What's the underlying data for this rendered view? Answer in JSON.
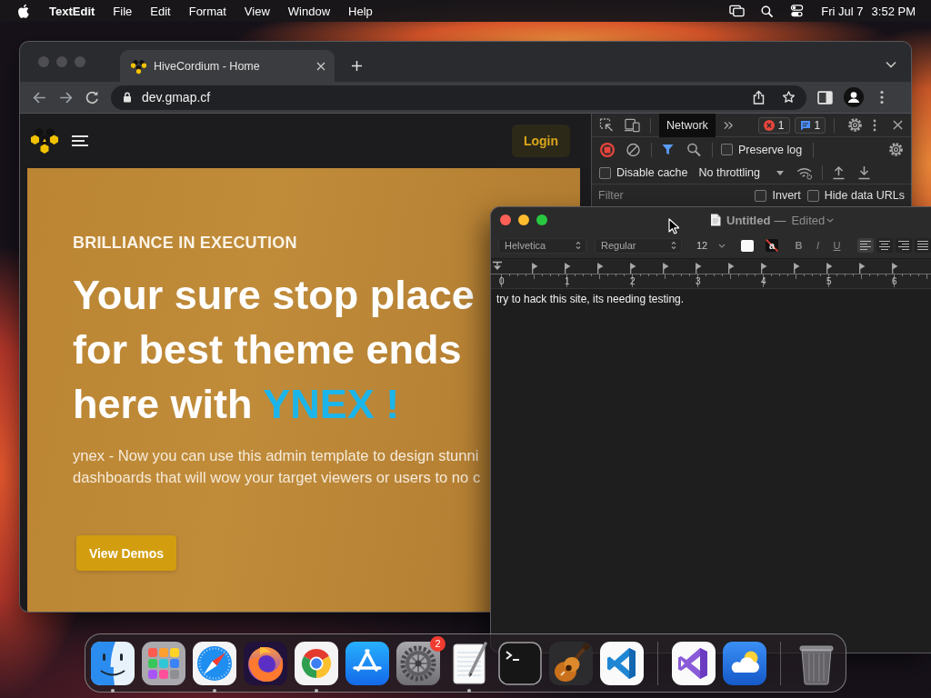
{
  "menu_bar": {
    "app_name": "TextEdit",
    "menus": [
      "File",
      "Edit",
      "Format",
      "View",
      "Window",
      "Help"
    ],
    "date": "Fri Jul 7",
    "time": "3:52 PM"
  },
  "browser": {
    "tabs": [
      {
        "title": "HiveCordium - Home",
        "selected": true
      }
    ],
    "address": "dev.gmap.cf",
    "page": {
      "login_button": "Login",
      "eyebrow": "BRILLIANCE IN EXECUTION",
      "headline_lines": [
        "Your sure stop place",
        "for best theme ends",
        "here with"
      ],
      "headline_accent": "YNEX !",
      "description_lines": [
        "ynex - Now you can use this admin template to design stunni",
        "dashboards that will wow your target viewers or users to no c"
      ],
      "cta_button": "View Demos"
    },
    "devtools": {
      "tabs": [
        {
          "label": "Network",
          "selected": true
        }
      ],
      "error_count": "1",
      "message_count": "1",
      "recording": true,
      "preserve_log": {
        "label": "Preserve log",
        "checked": false
      },
      "disable_cache": {
        "label": "Disable cache",
        "checked": false
      },
      "throttling": "No throttling",
      "filter_placeholder": "Filter",
      "filter_options": [
        {
          "label": "Invert",
          "checked": false
        },
        {
          "label": "Hide data URLs",
          "checked": false
        }
      ]
    }
  },
  "textedit": {
    "title": "Untitled",
    "separator": "—",
    "status": "Edited",
    "font": "Helvetica",
    "style": "Regular",
    "size": "12",
    "highlight_label": "a",
    "style_buttons": [
      {
        "kind": "bold",
        "label": "B"
      },
      {
        "kind": "italic",
        "label": "I"
      },
      {
        "kind": "underline",
        "label": "U"
      }
    ],
    "alignments": [
      {
        "kind": "left",
        "selected": true
      },
      {
        "kind": "center",
        "selected": false
      },
      {
        "kind": "right",
        "selected": false
      },
      {
        "kind": "justify",
        "selected": false
      }
    ],
    "ruler_numbers": [
      "0",
      "1",
      "2",
      "3",
      "4",
      "5",
      "6"
    ],
    "text": "try to hack this site, its needing testing."
  },
  "dock": {
    "items": [
      {
        "kind": "finder",
        "running": true
      },
      {
        "kind": "launchpad",
        "running": false
      },
      {
        "kind": "safari",
        "running": true
      },
      {
        "kind": "firefox",
        "running": false
      },
      {
        "kind": "chrome",
        "running": true
      },
      {
        "kind": "appstore",
        "running": false
      },
      {
        "kind": "settings",
        "running": false,
        "badge": "2"
      },
      {
        "kind": "textedit",
        "running": true
      },
      {
        "kind": "terminal",
        "running": false
      },
      {
        "kind": "garageband",
        "running": false
      },
      {
        "kind": "vscode",
        "running": false
      },
      {
        "kind": "separator"
      },
      {
        "kind": "visualstudio",
        "running": false
      },
      {
        "kind": "weather",
        "running": false
      },
      {
        "kind": "separator"
      },
      {
        "kind": "trash",
        "running": false
      }
    ]
  }
}
